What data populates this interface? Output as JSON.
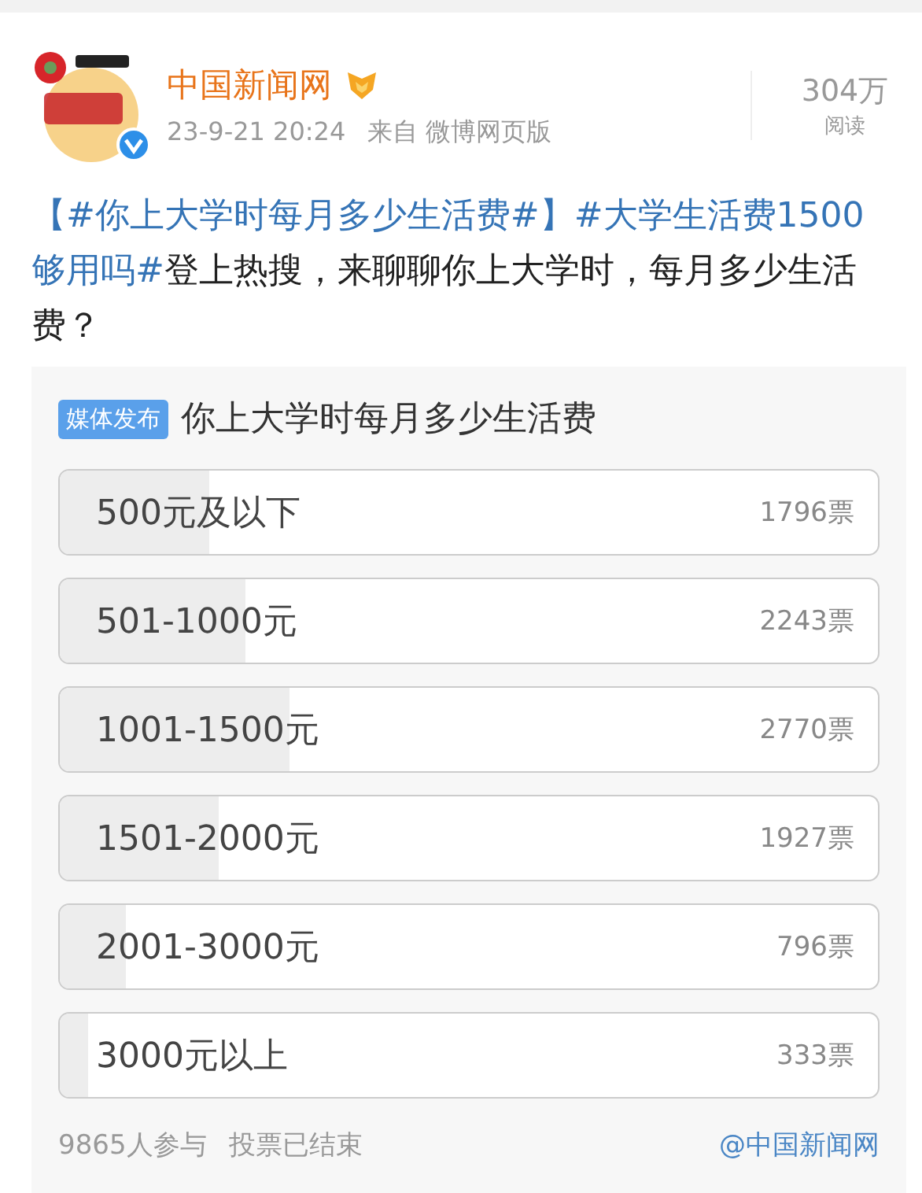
{
  "post": {
    "author": "中国新闻网",
    "time": "23-9-21 20:24",
    "source": "来自 微博网页版",
    "reads": "304万",
    "reads_label": "阅读",
    "verified": true,
    "text": [
      {
        "kind": "hashtag",
        "text": "【#你上大学时每月多少生活费#】"
      },
      {
        "kind": "hashtag",
        "text": "#大学生活费1500够用吗#"
      },
      {
        "kind": "plain",
        "text": "登上热搜，来聊聊你上大学时，每月多少生活费？"
      }
    ]
  },
  "poll": {
    "tag": "媒体发布",
    "title": "你上大学时每月多少生活费",
    "options": [
      {
        "label": "500元及以下",
        "votes": "1796票",
        "level": 0.182
      },
      {
        "label": "501-1000元",
        "votes": "2243票",
        "level": 0.227
      },
      {
        "label": "1001-1500元",
        "votes": "2770票",
        "level": 0.281
      },
      {
        "label": "1501-2000元",
        "votes": "1927票",
        "level": 0.195
      },
      {
        "label": "2001-3000元",
        "votes": "796票",
        "level": 0.081
      },
      {
        "label": "3000元以上",
        "votes": "333票",
        "level": 0.034
      }
    ],
    "participants": "9865人参与",
    "status": "投票已结束",
    "author_link": "@中国新闻网"
  }
}
